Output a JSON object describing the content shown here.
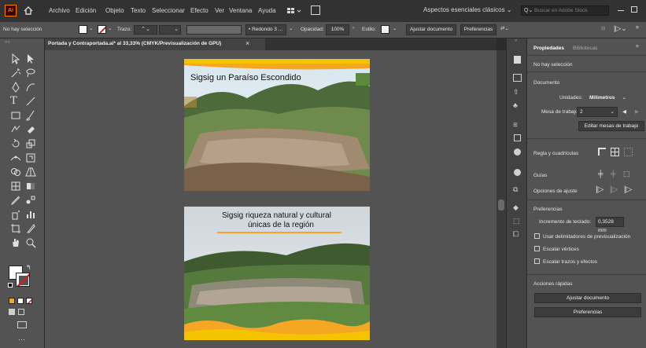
{
  "menu": {
    "items": [
      "Archivo",
      "Edición",
      "Objeto",
      "Texto",
      "Seleccionar",
      "Efecto",
      "Ver",
      "Ventana",
      "Ayuda"
    ],
    "workspace": "Aspectos esenciales clásicos",
    "search_placeholder": "Buscar en Adobe Stock"
  },
  "control": {
    "selection_status": "No hay selección",
    "stroke_label": "Trazo:",
    "brush_label": "Redondo 3 ...",
    "opacity_label": "Opacidad:",
    "opacity_value": "100%",
    "style_label": "Estilo:",
    "fit_document": "Ajustar documento",
    "preferences": "Preferencias"
  },
  "document": {
    "tab_title": "Portada y Contraportada.ai* al 33,33% (CMYK/Previsualización de GPU)",
    "close": "×"
  },
  "artboards": {
    "top_title": "Sigsig un Paraíso Escondido",
    "bottom_title_line1": "Sigsig riqueza natural y cultural",
    "bottom_title_line2": "únicas de la región"
  },
  "panel": {
    "tabs": [
      "Propiedades",
      "Bibliotecas"
    ],
    "no_selection": "No hay selección",
    "document_header": "Documento",
    "units_label": "Unidades:",
    "units_value": "Milímetros",
    "artboard_label": "Mesa de trabajo:",
    "artboard_value": "2",
    "edit_artboards": "Editar mesas de trabajo",
    "rulers_grids": "Regla y cuadrículas",
    "guides": "Guías",
    "snap_options": "Opciones de ajuste",
    "preferences_header": "Preferencias",
    "keyboard_increment_label": "Incremento de teclado:",
    "keyboard_increment_value": "0,3528 mm",
    "checkbox_preview_bounds": "Usar delimitadores de previsualización",
    "checkbox_scale_corners": "Escalar vértices",
    "checkbox_scale_strokes": "Escalar trazos y efectos",
    "quick_actions": "Acciones rápidas",
    "fit_document_button": "Ajustar documento",
    "preferences_button": "Preferencias"
  },
  "colors": {
    "accent_orange": "#f5a623",
    "panel_bg": "#535353",
    "dark_bg": "#323232",
    "ai_orange": "#ff7c00"
  }
}
